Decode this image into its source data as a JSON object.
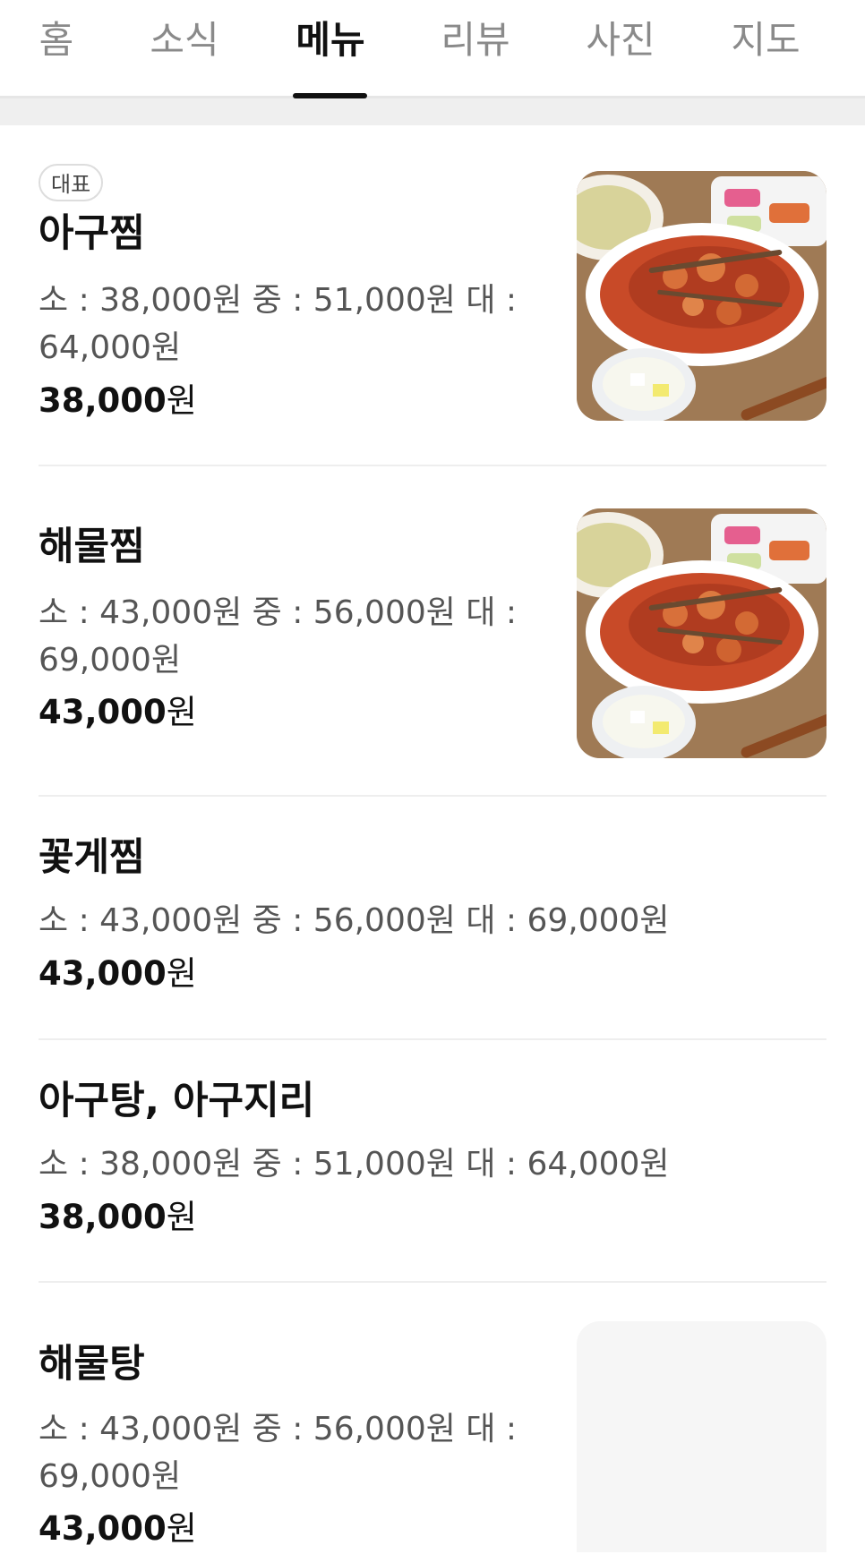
{
  "tabs": [
    {
      "label": "홈",
      "active": false
    },
    {
      "label": "소식",
      "active": false
    },
    {
      "label": "메뉴",
      "active": true
    },
    {
      "label": "리뷰",
      "active": false
    },
    {
      "label": "사진",
      "active": false
    },
    {
      "label": "지도",
      "active": false
    }
  ],
  "menu": [
    {
      "badge": "대표",
      "name": "아구찜",
      "description": "소 : 38,000원 중 : 51,000원 대 : 64,000원",
      "price_number": "38,000",
      "price_unit": "원",
      "image": "braised-monkfish-photo"
    },
    {
      "name": "해물찜",
      "description": "소 : 43,000원 중 : 56,000원 대 : 69,000원",
      "price_number": "43,000",
      "price_unit": "원",
      "image": "braised-monkfish-photo"
    },
    {
      "name": "꽃게찜",
      "description": "소 : 43,000원 중 : 56,000원 대 : 69,000원",
      "price_number": "43,000",
      "price_unit": "원"
    },
    {
      "name": "아구탕, 아구지리",
      "description": "소 : 38,000원 중 : 51,000원 대 : 64,000원",
      "price_number": "38,000",
      "price_unit": "원"
    },
    {
      "name": "해물탕",
      "description": "소 : 43,000원 중 : 56,000원 대 : 69,000원",
      "price_number": "43,000",
      "price_unit": "원",
      "image": "image-placeholder"
    }
  ],
  "colors": {
    "active_tab": "#111111",
    "inactive_tab": "#8a8a8a",
    "description": "#555555",
    "divider": "#eeeeee"
  }
}
